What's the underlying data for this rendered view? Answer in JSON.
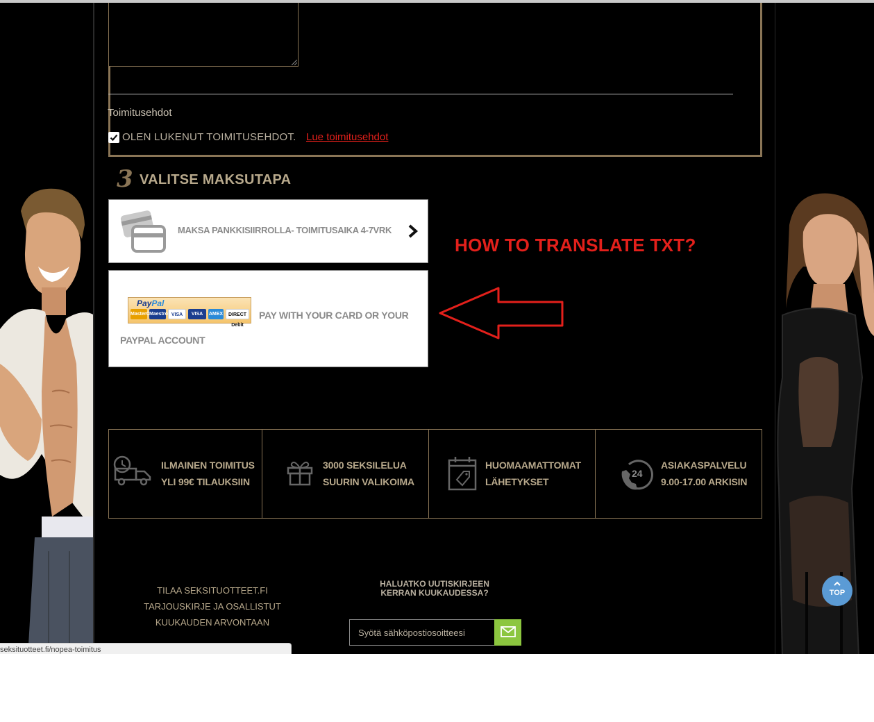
{
  "terms": {
    "heading": "Toimitusehdot",
    "checkbox_label": "OLEN LUKENUT TOIMITUSEHDOT.",
    "link_text": "Lue toimitusehdot",
    "checked": true
  },
  "payment": {
    "step_number": "3",
    "title": "VALITSE MAKSUTAPA",
    "options": [
      {
        "label": "MAKSA PANKKISIIRROLLA- TOIMITUSAIKA 4-7VRK",
        "icon": "credit-card-icon"
      },
      {
        "label": "PAY WITH YOUR CARD OR YOUR PAYPAL ACCOUNT",
        "logo": {
          "brand": "PayPal",
          "brand_a": "Pay",
          "brand_b": "Pal",
          "cards": [
            "MasterCard",
            "Maestro",
            "VISA",
            "VISA",
            "AMEX",
            "DIRECT Debit"
          ]
        }
      }
    ]
  },
  "annotation": {
    "text": "HOW TO TRANSLATE TXT?",
    "color": "#e3201b"
  },
  "features": [
    {
      "icon": "delivery-truck-icon",
      "line1": "ILMAINEN TOIMITUS",
      "line2": "YLI 99€ TILAUKSIIN"
    },
    {
      "icon": "gift-icon",
      "line1": "3000 SEKSILELUA",
      "line2": "SUURIN VALIKOIMA"
    },
    {
      "icon": "calendar-tag-icon",
      "line1": "HUOMAAMATTOMAT",
      "line2": "LÄHETYKSET"
    },
    {
      "icon": "phone-24-icon",
      "line1": "ASIAKASPALVELU",
      "line2": "9.00-17.00 ARKISIN",
      "badge": "24"
    }
  ],
  "newsletter": {
    "promo_line1": "TILAA SEKSITUOTTEET.FI",
    "promo_line2": "TARJOUSKIRJE JA OSALLISTUT",
    "promo_line3": "KUUKAUDEN ARVONTAAN",
    "question": "HALUATKO UUTISKIRJEEN KERRAN KUUKAUDESSA?",
    "input_placeholder": "Syötä sähköpostiosoitteesi",
    "submit_icon": "envelope-icon"
  },
  "top_button": {
    "label": "TOP",
    "icon": "chevron-up-icon"
  },
  "status_bar": {
    "url": "seksituotteet.fi/nopea-toimitus"
  },
  "colors": {
    "gold": "#8a7556",
    "gold_text": "#b8a98c",
    "accent_red": "#e3201b",
    "newsletter_green": "#8cc63f",
    "top_blue": "#5b9bd5"
  }
}
